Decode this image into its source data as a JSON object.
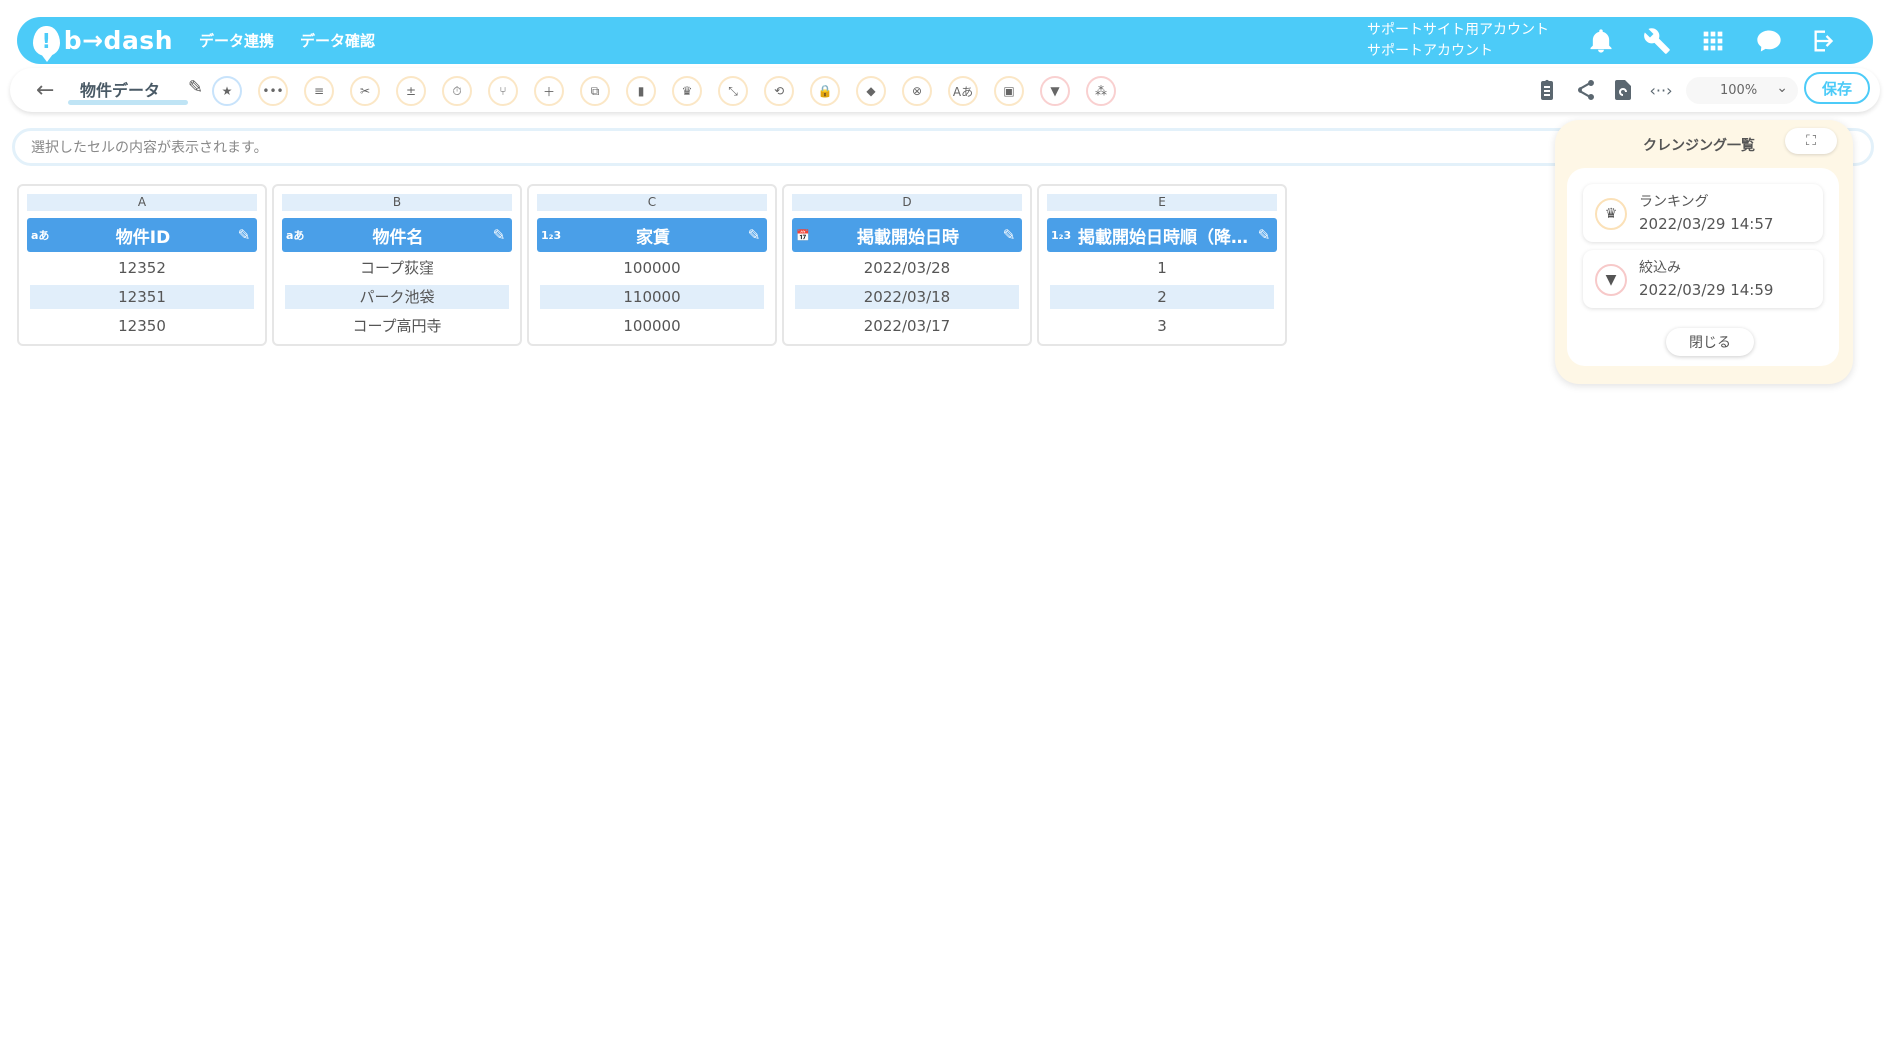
{
  "header": {
    "logo_text": "b→dash",
    "nav": [
      "データ連携",
      "データ確認"
    ],
    "account_line1": "サポートサイト用アカウント",
    "account_line2": "サポートアカウント"
  },
  "toolbar": {
    "dataset_name": "物件データ",
    "zoom": "100%",
    "save_label": "保存"
  },
  "cell_viewer": {
    "placeholder": "選択したセルの内容が表示されます。"
  },
  "columns": [
    {
      "letter": "A",
      "type": "aあ",
      "title": "物件ID",
      "cells": [
        "12352",
        "12351",
        "12350"
      ]
    },
    {
      "letter": "B",
      "type": "aあ",
      "title": "物件名",
      "cells": [
        "コープ荻窪",
        "パーク池袋",
        "コープ高円寺"
      ]
    },
    {
      "letter": "C",
      "type": "1₂3",
      "title": "家賃",
      "cells": [
        "100000",
        "110000",
        "100000"
      ]
    },
    {
      "letter": "D",
      "type": "📅",
      "title": "掲載開始日時",
      "cells": [
        "2022/03/28",
        "2022/03/18",
        "2022/03/17"
      ]
    },
    {
      "letter": "E",
      "type": "1₂3",
      "title": "掲載開始日時順（降…",
      "cells": [
        "1",
        "2",
        "3"
      ]
    }
  ],
  "cleansing_panel": {
    "title": "クレンジング一覧",
    "items": [
      {
        "name": "ランキング",
        "date": "2022/03/29 14:57",
        "icon": "crown-icon"
      },
      {
        "name": "絞込み",
        "date": "2022/03/29 14:59",
        "icon": "filter-icon"
      }
    ],
    "close_label": "閉じる"
  },
  "colors": {
    "brand": "#4ccbf8",
    "column_header": "#4a9fe8",
    "panel_bg": "#fef7e6"
  }
}
